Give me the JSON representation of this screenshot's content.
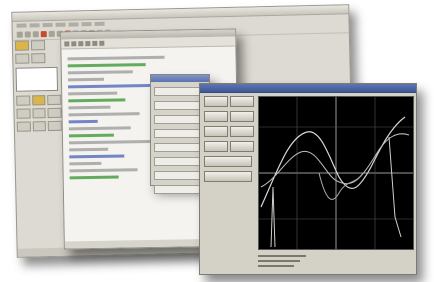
{
  "windows": {
    "ide": {
      "menu_items": 9,
      "toolbar_buttons": 12
    },
    "editor": {
      "code_lines": 18
    },
    "scope": {
      "buttons": [
        "",
        "",
        "",
        "",
        "",
        "",
        "",
        "",
        "",
        ""
      ],
      "plot": {
        "background": "#000000",
        "trace_color": "#d8d8d8",
        "grid_color": "#9a9a9a"
      }
    }
  },
  "colors": {
    "accent_title": "#3e5796",
    "toolbar_icon_red": "#c74b2c"
  }
}
